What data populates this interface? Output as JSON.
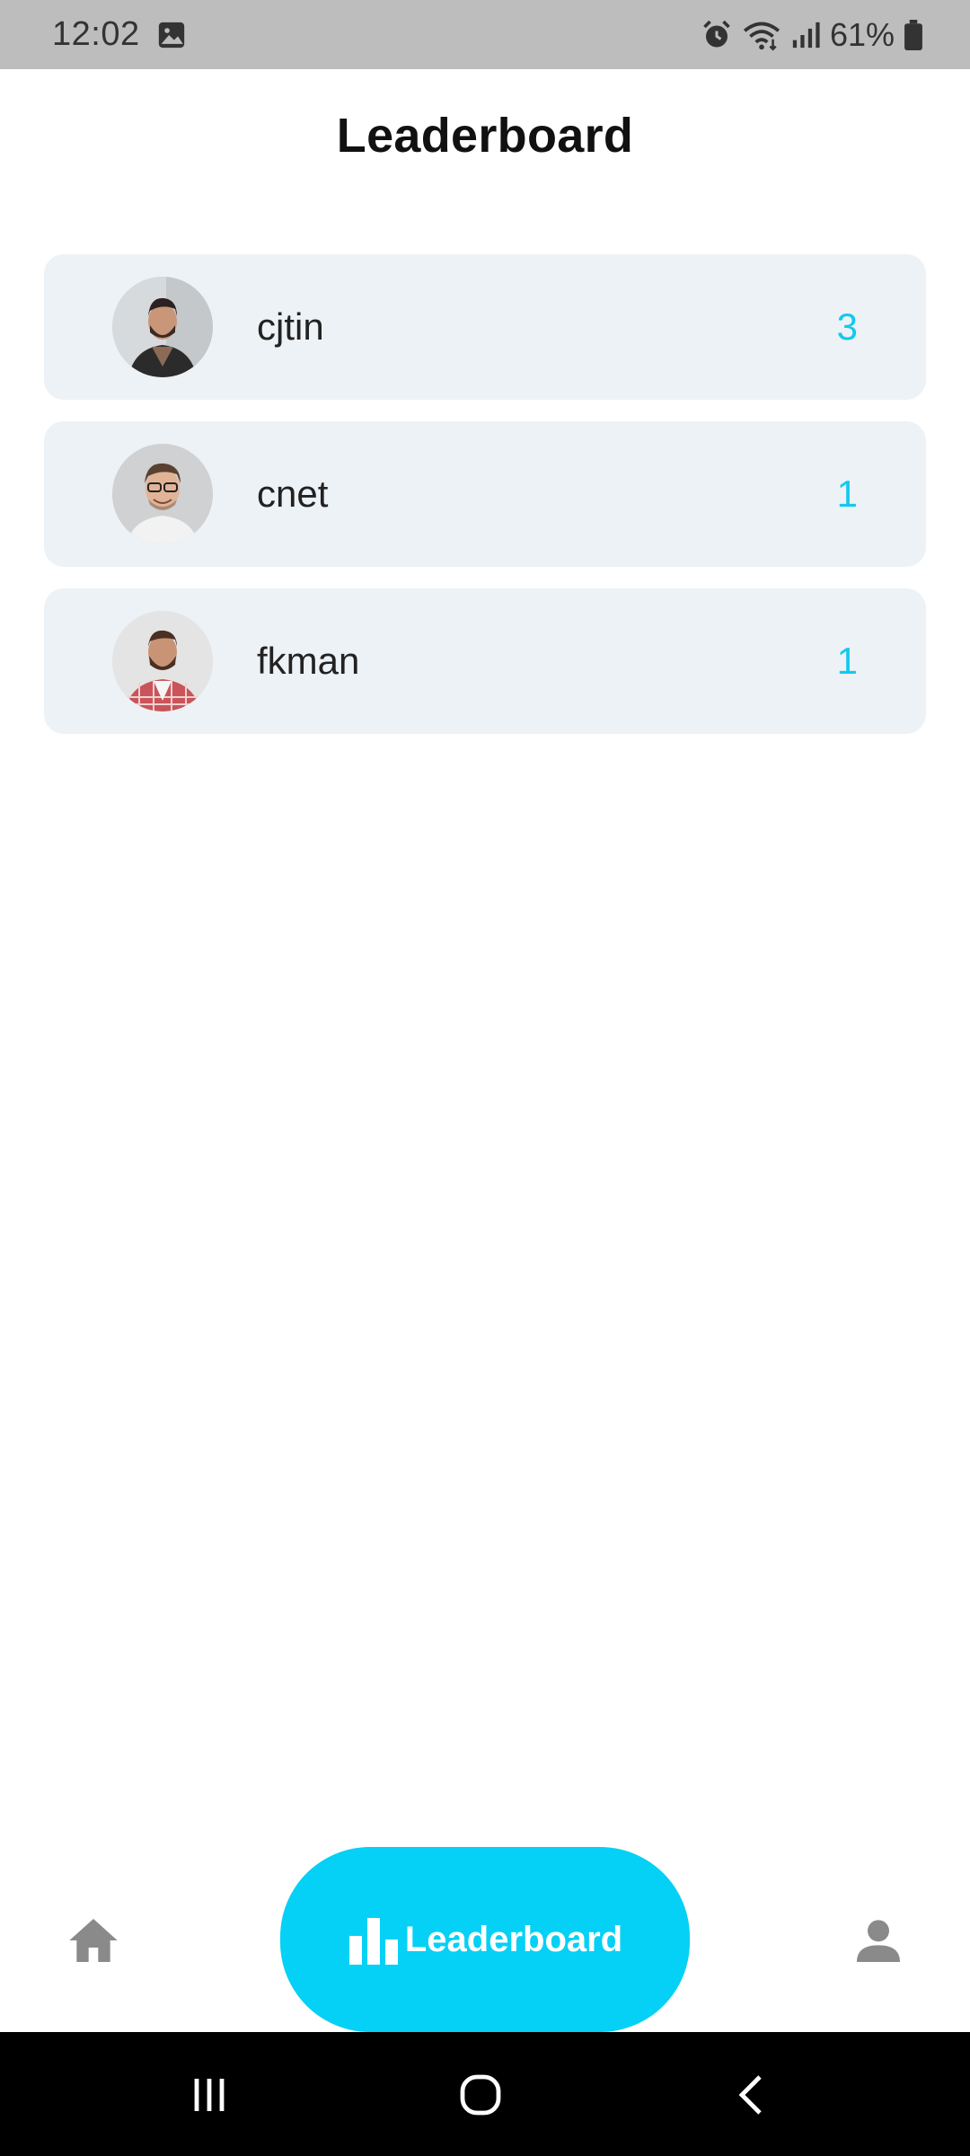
{
  "status_bar": {
    "time": "12:02",
    "battery_percent": "61%",
    "icons": [
      "image-icon",
      "alarm-icon",
      "wifi-icon",
      "signal-icon",
      "battery-icon"
    ]
  },
  "header": {
    "title": "Leaderboard"
  },
  "leaderboard": {
    "entries": [
      {
        "name": "cjtin",
        "score": "3",
        "avatar": "avatar-photo"
      },
      {
        "name": "cnet",
        "score": "1",
        "avatar": "avatar-photo"
      },
      {
        "name": "fkman",
        "score": "1",
        "avatar": "avatar-photo"
      }
    ]
  },
  "bottom_nav": {
    "items": [
      {
        "icon": "home-icon",
        "label": ""
      },
      {
        "icon": "bar-chart-icon",
        "label": "Leaderboard",
        "active": true
      },
      {
        "icon": "person-icon",
        "label": ""
      }
    ]
  },
  "system_nav": {
    "buttons": [
      "recent-apps-icon",
      "home-circle-icon",
      "back-icon"
    ]
  },
  "colors": {
    "accent": "#04d1f5",
    "score": "#12c9ee",
    "row_background": "#edf2f6",
    "status_bar": "#bdbdbd",
    "nav_icon": "#8a8a8a"
  }
}
